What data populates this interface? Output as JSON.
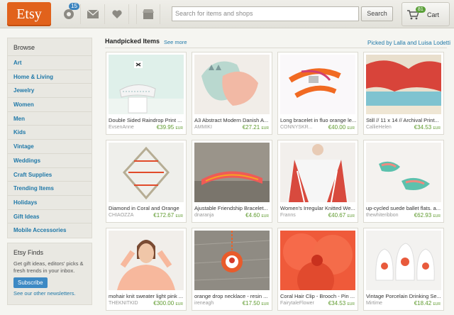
{
  "header": {
    "logo": "Etsy",
    "activity_count": "15",
    "search_placeholder": "Search for items and shops",
    "search_button": "Search",
    "cart_count": "81",
    "cart_label": "Cart"
  },
  "sidebar": {
    "browse_title": "Browse",
    "categories": [
      "Art",
      "Home & Living",
      "Jewelry",
      "Women",
      "Men",
      "Kids",
      "Vintage",
      "Weddings",
      "Craft Supplies",
      "Trending Items",
      "Holidays",
      "Gift Ideas",
      "Mobile Accessories"
    ]
  },
  "finds": {
    "title": "Etsy Finds",
    "text": "Get gift ideas, editors' picks & fresh trends in your inbox.",
    "button": "Subscribe",
    "more": "See our other newsletters."
  },
  "main": {
    "heading": "Handpicked Items",
    "see_more": "See more",
    "picked_by": "Picked by Lalla and Luisa Lodetti",
    "items": [
      {
        "title": "Double Sided Raindrop Print ...",
        "shop": "EvsenAnne",
        "price": "€39.95",
        "currency": "EUR"
      },
      {
        "title": "A3 Abstract Modern Danish A...",
        "shop": "AMMIKI",
        "price": "€27.21",
        "currency": "EUR"
      },
      {
        "title": "Long bracelet in fluo orange le...",
        "shop": "CONNYSKR...",
        "price": "€40.00",
        "currency": "EUR"
      },
      {
        "title": "Still // 11 x 14 // Archival Print...",
        "shop": "CallieHelen",
        "price": "€34.53",
        "currency": "EUR"
      },
      {
        "title": "Diamond in Coral and Orange",
        "shop": "CHIAOZZA",
        "price": "€172.67",
        "currency": "EUR"
      },
      {
        "title": "Ajustable Friendship Bracelet...",
        "shop": "dnaranja",
        "price": "€4.60",
        "currency": "EUR"
      },
      {
        "title": "Women's Irregular Knitted We...",
        "shop": "Franns",
        "price": "€40.67",
        "currency": "EUR"
      },
      {
        "title": "up-cycled suede ballet flats. a...",
        "shop": "thewhiteribbon",
        "price": "€62.93",
        "currency": "EUR"
      },
      {
        "title": "mohair knit sweater light pink ...",
        "shop": "THEKNITKID",
        "price": "€300.00",
        "currency": "EUR"
      },
      {
        "title": "orange drop necklace - resin ...",
        "shop": "ireneagh",
        "price": "€17.50",
        "currency": "EUR"
      },
      {
        "title": "Coral Hair Clip - Brooch - Pin ...",
        "shop": "FairytaleFlower",
        "price": "€34.53",
        "currency": "EUR"
      },
      {
        "title": "Vintage Porcelain Drinking Se...",
        "shop": "Mirtime",
        "price": "€18.42",
        "currency": "EUR"
      }
    ]
  }
}
